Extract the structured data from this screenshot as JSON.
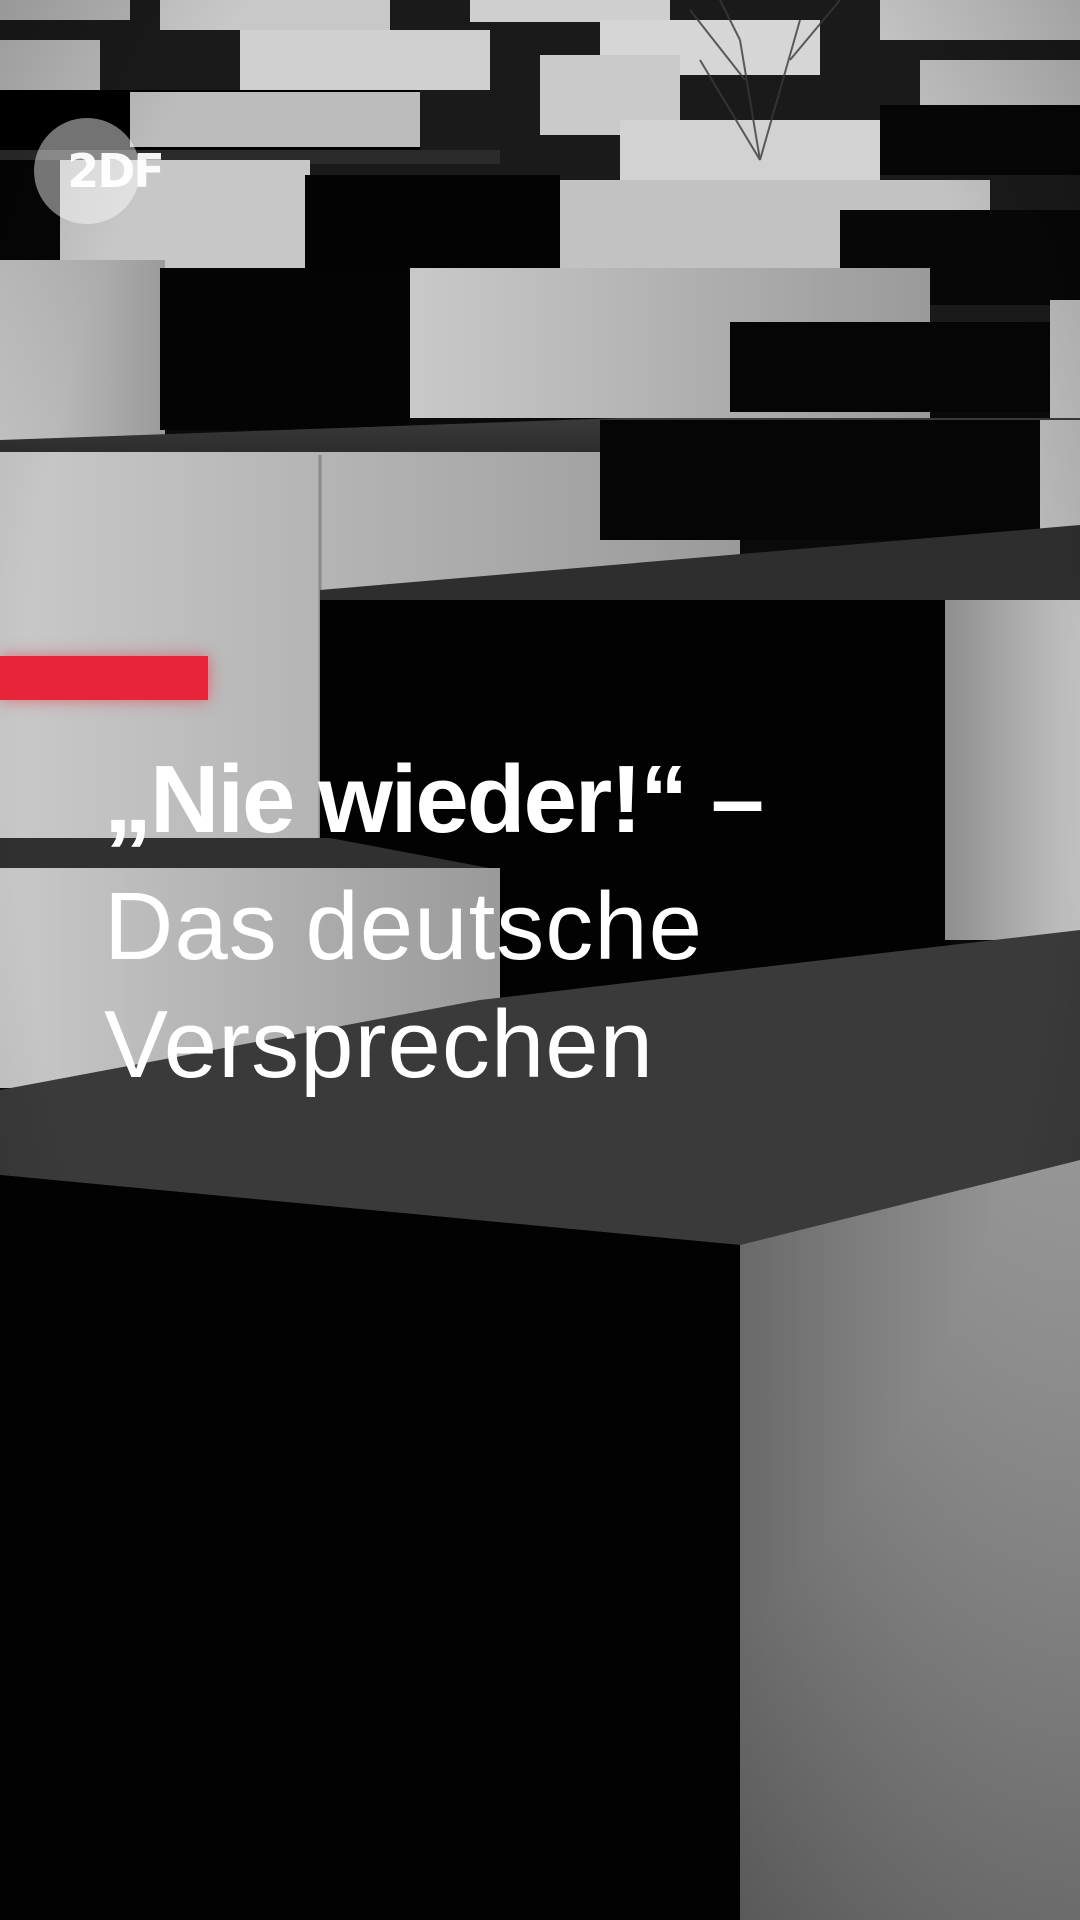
{
  "logo": {
    "text": "2DF",
    "icon": "zdf-logo-icon"
  },
  "accent_color": "#e8233a",
  "headline": {
    "line1": "„Nie wieder!“ –",
    "line2": "Das deutsche",
    "line3": "Versprechen"
  },
  "background": {
    "description_icon": "memorial-concrete-blocks-photo"
  }
}
